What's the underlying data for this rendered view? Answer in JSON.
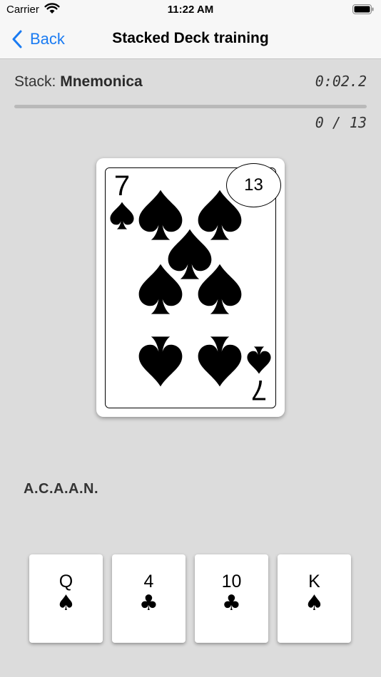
{
  "status_bar": {
    "carrier": "Carrier",
    "time": "11:22 AM",
    "icons": [
      "wifi-icon",
      "battery-icon"
    ]
  },
  "nav": {
    "back_label": "Back",
    "title": "Stacked Deck training"
  },
  "stack": {
    "label": "Stack:",
    "name": "Mnemonica"
  },
  "timer": "0:02.2",
  "progress": {
    "text": "0 / 13",
    "fraction": 0
  },
  "current_card": {
    "rank": "7",
    "suit": "spades",
    "suit_glyph": "♠",
    "badge": "13"
  },
  "hint": "A.C.A.A.N.",
  "choices": [
    {
      "rank": "Q",
      "suit": "spades",
      "suit_glyph": "♠"
    },
    {
      "rank": "4",
      "suit": "clubs",
      "suit_glyph": "♣"
    },
    {
      "rank": "10",
      "suit": "clubs",
      "suit_glyph": "♣"
    },
    {
      "rank": "K",
      "suit": "spades",
      "suit_glyph": "♠"
    }
  ],
  "colors": {
    "accent": "#1a7bf2",
    "background": "#dcdcdc",
    "nav_background": "#f7f7f7"
  }
}
